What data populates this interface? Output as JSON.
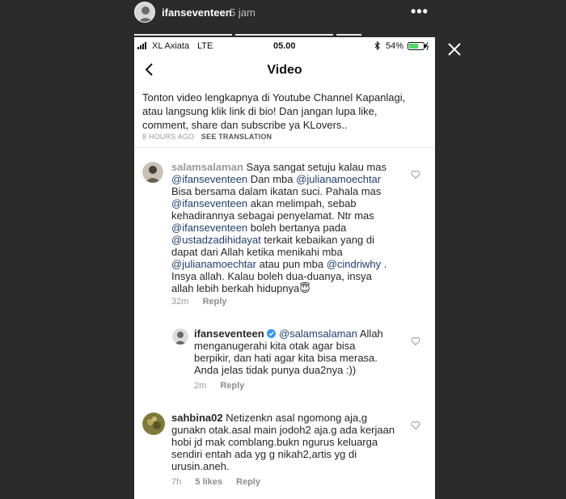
{
  "story": {
    "username": "ifanseventeen",
    "time": "5 jam",
    "more": "•••"
  },
  "status_bar": {
    "carrier": "XL Axiata",
    "network": "LTE",
    "time": "05.00",
    "battery": "54%"
  },
  "nav": {
    "title": "Video"
  },
  "caption": {
    "text": "Tonton video lengkapnya di Youtube Channel Kapanlagi, atau langsung klik link di bio! Dan jangan lupa like, comment, share dan subscribe ya KLovers..",
    "age": "8 HOURS AGO",
    "see_translation": "SEE TRANSLATION"
  },
  "comments": [
    {
      "username": "salamsalaman",
      "lines": [
        "Saya sangat setuju kalau mas",
        "@ifanseventeen Dan mba @julianamoechtar",
        "Bisa bersama dalam ikatan suci. Pahala mas",
        "@ifanseventeen akan melimpah, sebab",
        "kehadirannya sebagai penyelamat. Ntr mas",
        "@ifanseventeen boleh bertanya pada",
        "@ustadzadihidayat terkait kebaikan yang di",
        "dapat dari Allah ketika menikahi mba",
        "@julianamoechtar atau pun mba @cindriwhy .",
        "Insya allah. Kalau boleh dua-duanya, insya",
        "allah lebih berkah hidupnya😇"
      ],
      "time": "32m",
      "reply": "Reply"
    },
    {
      "username": "ifanseventeen",
      "mention": "@salamsalaman",
      "lines": [
        "Allah",
        "menganugerahi kita otak agar bisa",
        "berpikir, dan hati agar kita bisa merasa.",
        "Anda jelas tidak punya dua2nya :))"
      ],
      "time": "2m",
      "reply": "Reply"
    },
    {
      "username": "sahbina02",
      "lines": [
        "Netizenkn asal ngomong aja,g",
        "gunakn otak.asal main jodoh2 aja.g ada kerjaan",
        "hobi jd mak comblang.bukn ngurus keluarga",
        "sendiri entah ada yg g nikah2,artis yg di",
        "urusin.aneh."
      ],
      "time": "7h",
      "likes": "5 likes",
      "reply": "Reply"
    }
  ],
  "colors": {
    "background": "#2b2b2b",
    "mention": "#1f3d6b",
    "battery": "#4cd964",
    "verified": "#3897f0"
  }
}
